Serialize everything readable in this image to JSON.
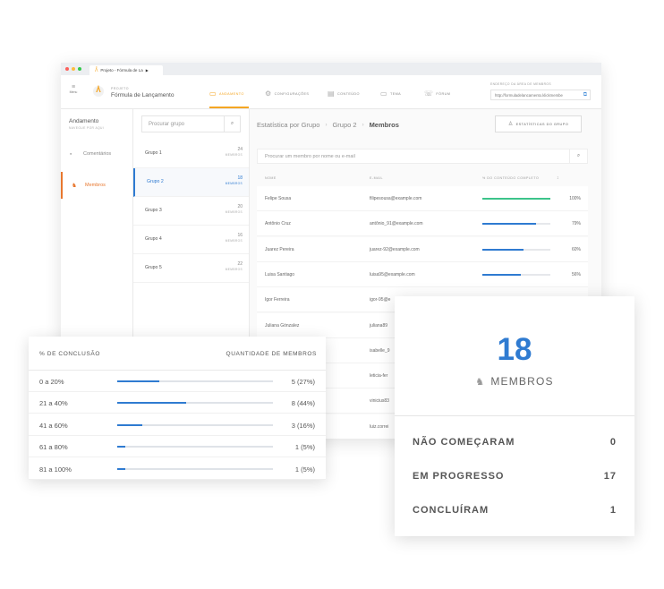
{
  "browser": {
    "tab_title": "Projeto - Fórmula de La",
    "dot_colors": [
      "#fc605c",
      "#fdbc40",
      "#34c84a"
    ]
  },
  "appbar": {
    "menu_label": "Menu",
    "project_label": "PROJETO",
    "project_name": "Fórmula de Lançamento",
    "nav": [
      {
        "label": "ANDAMENTO",
        "icon": "progress-icon",
        "active": true
      },
      {
        "label": "CONFIGURAÇÕES",
        "icon": "gear-icon",
        "active": false
      },
      {
        "label": "CONTEÚDO",
        "icon": "document-icon",
        "active": false
      },
      {
        "label": "TEMA",
        "icon": "monitor-icon",
        "active": false
      },
      {
        "label": "FÓRUM",
        "icon": "chat-icon",
        "active": false
      }
    ],
    "address_label": "ENDEREÇO DA ÁREA DE MEMBROS",
    "address_value": "http://formuladelancamento.klickmembe"
  },
  "sidebar": {
    "title": "Andamento",
    "subtitle": "NAVEGUE POR AQUI",
    "items": [
      {
        "label": "Comentários",
        "icon": "comment-icon",
        "active": false
      },
      {
        "label": "Membros",
        "icon": "users-icon",
        "active": true
      }
    ]
  },
  "groups": {
    "search_placeholder": "Procurar grupo",
    "members_unit": "MEMBROS",
    "items": [
      {
        "name": "Grupo 1",
        "count": "24"
      },
      {
        "name": "Grupo 2",
        "count": "18"
      },
      {
        "name": "Grupo 3",
        "count": "20"
      },
      {
        "name": "Grupo 4",
        "count": "16"
      },
      {
        "name": "Grupo 5",
        "count": "22"
      }
    ]
  },
  "main": {
    "breadcrumb": [
      "Estatística por Grupo",
      "Grupo 2",
      "Membros"
    ],
    "stats_button": "ESTATÍSTICAS DO GRUPO",
    "search_placeholder": "Procurar um membro por nome ou e-mail",
    "columns": [
      "NOME",
      "E-MAIL",
      "% DO CONTEÚDO COMPLETO"
    ],
    "rows": [
      {
        "name": "Felipe Sousa",
        "email": "filipesousa@example.com",
        "progress": 100,
        "pct": "100%"
      },
      {
        "name": "Antônio Cruz",
        "email": "antônio_91@example.com",
        "progress": 79,
        "pct": "79%"
      },
      {
        "name": "Juarez Pereira",
        "email": "juarez-92@example.com",
        "progress": 60,
        "pct": "60%"
      },
      {
        "name": "Luisa Santiago",
        "email": "luisa95@example.com",
        "progress": 56,
        "pct": "56%"
      },
      {
        "name": "Igor Ferreira",
        "email": "igor-95@e",
        "progress": null,
        "pct": ""
      },
      {
        "name": "Juliana Gónzalez",
        "email": "juliana89",
        "progress": null,
        "pct": ""
      },
      {
        "name": "",
        "email": "isabelle_9",
        "progress": null,
        "pct": ""
      },
      {
        "name": "",
        "email": "leticia-fer",
        "progress": null,
        "pct": ""
      },
      {
        "name": "",
        "email": "vinicius83",
        "progress": null,
        "pct": ""
      },
      {
        "name": "",
        "email": "luiz.correi",
        "progress": null,
        "pct": ""
      }
    ]
  },
  "completion_card": {
    "col_left": "% DE CONCLUSÃO",
    "col_right": "QUANTIDADE DE MEMBROS",
    "rows": [
      {
        "range": "0 a 20%",
        "share": 27,
        "value": "5 (27%)"
      },
      {
        "range": "21 a 40%",
        "share": 44,
        "value": "8 (44%)"
      },
      {
        "range": "41 a 60%",
        "share": 16,
        "value": "3 (16%)"
      },
      {
        "range": "61 a 80%",
        "share": 5,
        "value": "1 (5%)"
      },
      {
        "range": "81 a 100%",
        "share": 5,
        "value": "1 (5%)"
      }
    ]
  },
  "members_card": {
    "count": "18",
    "label": "MEMBROS",
    "stats": [
      {
        "label": "NÃO COMEÇARAM",
        "value": "0"
      },
      {
        "label": "EM PROGRESSO",
        "value": "17"
      },
      {
        "label": "CONCLUÍRAM",
        "value": "1"
      }
    ]
  },
  "colors": {
    "accent_orange": "#e8772e",
    "accent_blue": "#2f7bd1",
    "complete_green": "#3cc48a",
    "bar_track": "#e6e8eb"
  }
}
